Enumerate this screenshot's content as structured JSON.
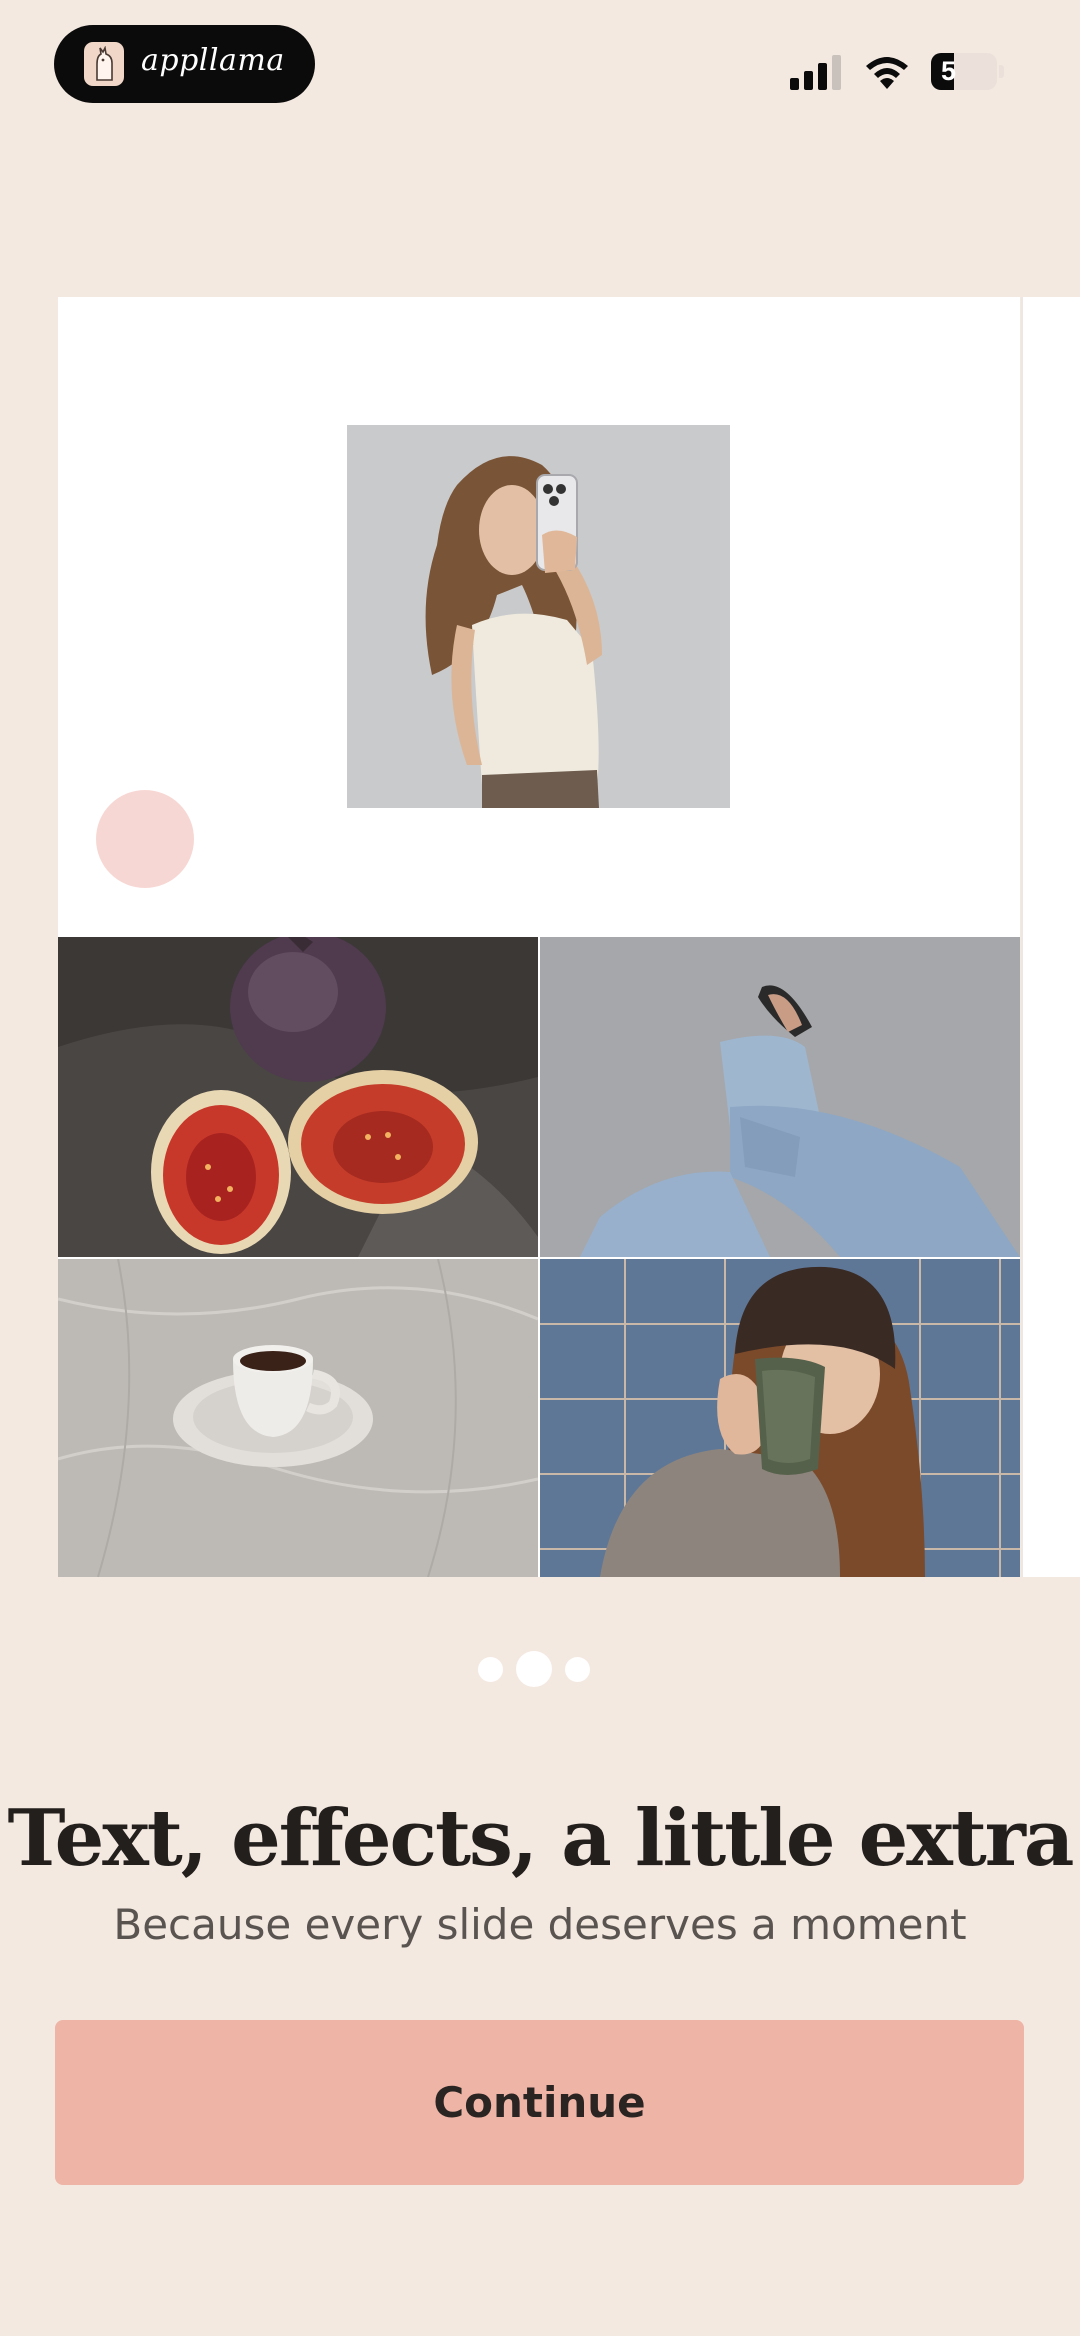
{
  "status_bar": {
    "app_name": "appllama",
    "battery_level_text": "5",
    "battery_level_percent": 5,
    "signal_icon": "cellular-signal-icon",
    "wifi_icon": "wifi-icon"
  },
  "onboarding": {
    "pager": {
      "total": 3,
      "active_index": 1
    },
    "title": "Text, effects, a little extra",
    "subtitle": "Because every slide deserves a moment",
    "continue_label": "Continue"
  },
  "colors": {
    "background": "#f4e9e1",
    "button": "#eeb4a5",
    "title_text": "#231f1d",
    "accent_dot": "#f7d7d3"
  }
}
